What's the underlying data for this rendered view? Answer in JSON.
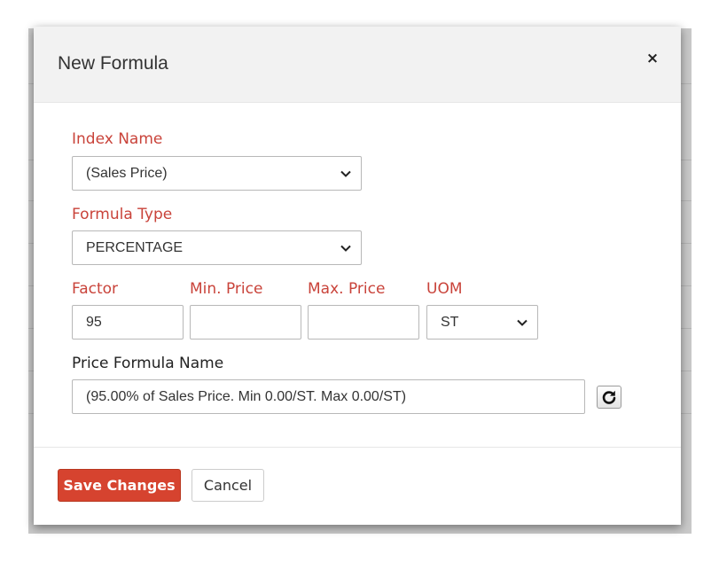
{
  "modal": {
    "title": "New Formula",
    "close_label": "×"
  },
  "form": {
    "index_name": {
      "label": "Index Name",
      "value": "(Sales Price)"
    },
    "formula_type": {
      "label": "Formula Type",
      "value": "PERCENTAGE"
    },
    "factor": {
      "label": "Factor",
      "value": "95"
    },
    "min_price": {
      "label": "Min. Price",
      "value": ""
    },
    "max_price": {
      "label": "Max. Price",
      "value": ""
    },
    "uom": {
      "label": "UOM",
      "value": "ST"
    },
    "price_formula_name": {
      "label": "Price Formula Name",
      "value": "(95.00% of Sales Price. Min 0.00/ST. Max 0.00/ST)"
    }
  },
  "footer": {
    "save_label": "Save Changes",
    "cancel_label": "Cancel"
  },
  "colors": {
    "label_accent": "#c9433a",
    "primary_button": "#d6432f",
    "header_bg": "#f2f2f2"
  },
  "icons": {
    "refresh": "refresh-icon",
    "close": "close-icon",
    "dropdown": "chevron-down-icon"
  }
}
